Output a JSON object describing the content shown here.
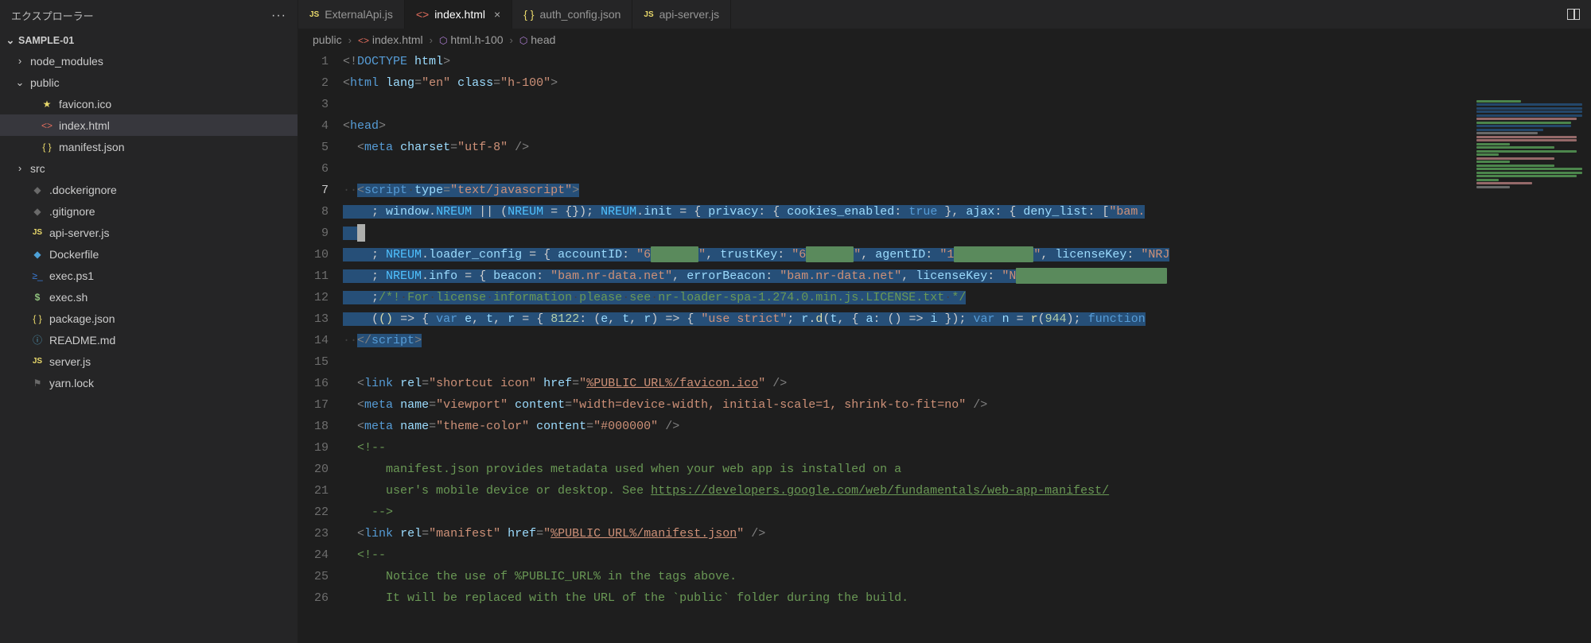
{
  "sidebar": {
    "title": "エクスプローラー",
    "project": "SAMPLE-01",
    "tree": [
      {
        "label": "node_modules",
        "kind": "folder",
        "collapsed": true,
        "depth": 1
      },
      {
        "label": "public",
        "kind": "folder",
        "collapsed": false,
        "depth": 1
      },
      {
        "label": "favicon.ico",
        "kind": "file",
        "icon": "star",
        "depth": 2
      },
      {
        "label": "index.html",
        "kind": "file",
        "icon": "html",
        "depth": 2,
        "active": true
      },
      {
        "label": "manifest.json",
        "kind": "file",
        "icon": "json",
        "depth": 2
      },
      {
        "label": "src",
        "kind": "folder",
        "collapsed": true,
        "depth": 1
      },
      {
        "label": ".dockerignore",
        "kind": "file",
        "icon": "docker-dim",
        "depth": 1
      },
      {
        "label": ".gitignore",
        "kind": "file",
        "icon": "dim",
        "depth": 1
      },
      {
        "label": "api-server.js",
        "kind": "file",
        "icon": "js",
        "depth": 1
      },
      {
        "label": "Dockerfile",
        "kind": "file",
        "icon": "docker",
        "depth": 1
      },
      {
        "label": "exec.ps1",
        "kind": "file",
        "icon": "ps",
        "depth": 1
      },
      {
        "label": "exec.sh",
        "kind": "file",
        "icon": "sh",
        "depth": 1
      },
      {
        "label": "package.json",
        "kind": "file",
        "icon": "json",
        "depth": 1
      },
      {
        "label": "README.md",
        "kind": "file",
        "icon": "md",
        "depth": 1
      },
      {
        "label": "server.js",
        "kind": "file",
        "icon": "js",
        "depth": 1
      },
      {
        "label": "yarn.lock",
        "kind": "file",
        "icon": "lock-dim",
        "depth": 1
      }
    ]
  },
  "tabs": [
    {
      "label": "ExternalApi.js",
      "icon": "js"
    },
    {
      "label": "index.html",
      "icon": "html",
      "active": true,
      "closable": true
    },
    {
      "label": "auth_config.json",
      "icon": "json"
    },
    {
      "label": "api-server.js",
      "icon": "js"
    }
  ],
  "breadcrumbs": [
    "public",
    "index.html",
    "html.h-100",
    "head"
  ],
  "editor": {
    "current_line": 7,
    "lines": [
      1,
      2,
      3,
      4,
      5,
      6,
      7,
      8,
      9,
      10,
      11,
      12,
      13,
      14,
      15,
      16,
      17,
      18,
      19,
      20,
      21,
      22,
      23,
      24,
      25,
      26
    ],
    "code": {
      "l1_doctype": "<!DOCTYPE html>",
      "l2_html_open": "<html lang=\"en\" class=\"h-100\">",
      "l4_head": "<head>",
      "l5_meta": "<meta charset=\"utf-8\" />",
      "l7_script_open": "<script type=\"text/javascript\">",
      "l8_nreum_init": "; window.NREUM || (NREUM = {}); NREUM.init = { privacy: { cookies_enabled: true }, ajax: { deny_list: [\"bam.",
      "l10_loader": "; NREUM.loader_config = { accountID: \"6\", trustKey: \"6\", agentID: \"1\", licenseKey: \"NRJ",
      "l11_info": "; NREUM.info = { beacon: \"bam.nr-data.net\", errorBeacon: \"bam.nr-data.net\", licenseKey: \"N",
      "l12_license": ";/*! For license information please see nr-loader-spa-1.274.0.min.js.LICENSE.txt */",
      "l13_iife": "(() => { var e, t, r = { 8122: (e, t, r) => { \"use strict\"; r.d(t, { a: () => i }); var n = r(944); function",
      "l14_script_close": "</script>",
      "l16_link": "<link rel=\"shortcut icon\" href=\"%PUBLIC_URL%/favicon.ico\" />",
      "l17_meta_viewport": "<meta name=\"viewport\" content=\"width=device-width, initial-scale=1, shrink-to-fit=no\" />",
      "l18_meta_theme": "<meta name=\"theme-color\" content=\"#000000\" />",
      "l19_comment_open": "<!--",
      "l20_comment": "manifest.json provides metadata used when your web app is installed on a",
      "l21_comment": "user's mobile device or desktop. See https://developers.google.com/web/fundamentals/web-app-manifest/",
      "l21_link": "https://developers.google.com/web/fundamentals/web-app-manifest/",
      "l22_comment_close": "-->",
      "l23_link_manifest": "<link rel=\"manifest\" href=\"%PUBLIC_URL%/manifest.json\" />",
      "l24_comment_open": "<!--",
      "l25_comment": "Notice the use of %PUBLIC_URL% in the tags above.",
      "l26_comment": "It will be replaced with the URL of the `public` folder during the build."
    }
  },
  "colors": {
    "selection": "#264f78",
    "redact": "#5a8a5c"
  }
}
